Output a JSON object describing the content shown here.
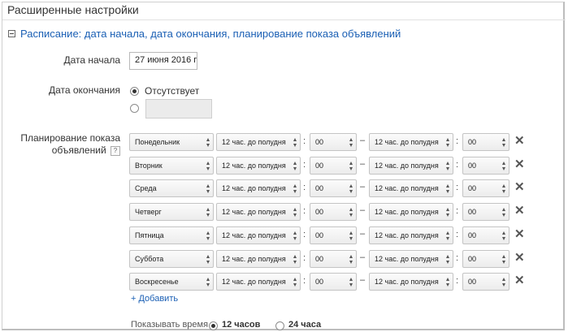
{
  "section_title": "Расширенные настройки",
  "schedule": {
    "header": "Расписание: дата начала, дата окончания, планирование показа объявлений"
  },
  "start_date": {
    "label": "Дата начала",
    "value": "27 июня 2016 г"
  },
  "end_date": {
    "label": "Дата окончания",
    "option_none": "Отсутствует"
  },
  "ad_schedule": {
    "label_line1": "Планирование показа",
    "label_line2": "объявлений",
    "help": "?",
    "rows": [
      {
        "day": "Понедельник",
        "start_hour": "12 час. до полудня",
        "start_min": "00",
        "end_hour": "12 час. до полудня",
        "end_min": "00"
      },
      {
        "day": "Вторник",
        "start_hour": "12 час. до полудня",
        "start_min": "00",
        "end_hour": "12 час. до полудня",
        "end_min": "00"
      },
      {
        "day": "Среда",
        "start_hour": "12 час. до полудня",
        "start_min": "00",
        "end_hour": "12 час. до полудня",
        "end_min": "00"
      },
      {
        "day": "Четверг",
        "start_hour": "12 час. до полудня",
        "start_min": "00",
        "end_hour": "12 час. до полудня",
        "end_min": "00"
      },
      {
        "day": "Пятница",
        "start_hour": "12 час. до полудня",
        "start_min": "00",
        "end_hour": "12 час. до полудня",
        "end_min": "00"
      },
      {
        "day": "Суббота",
        "start_hour": "12 час. до полудня",
        "start_min": "00",
        "end_hour": "12 час. до полудня",
        "end_min": "00"
      },
      {
        "day": "Воскресенье",
        "start_hour": "12 час. до полудня",
        "start_min": "00",
        "end_hour": "12 час. до полудня",
        "end_min": "00"
      }
    ],
    "colon": ":",
    "dash": "–",
    "remove_symbol": "✕",
    "add_link": "+ Добавить"
  },
  "time_format": {
    "label": "Показывать время",
    "option_12": "12 часов",
    "option_24": "24 часа"
  },
  "colors": {
    "link": "#1a5fb4",
    "disabled_bg": "#ebebeb"
  },
  "icons": {
    "collapse": "minus-square-icon",
    "remove": "close-icon",
    "select": "updown-arrows-icon"
  }
}
